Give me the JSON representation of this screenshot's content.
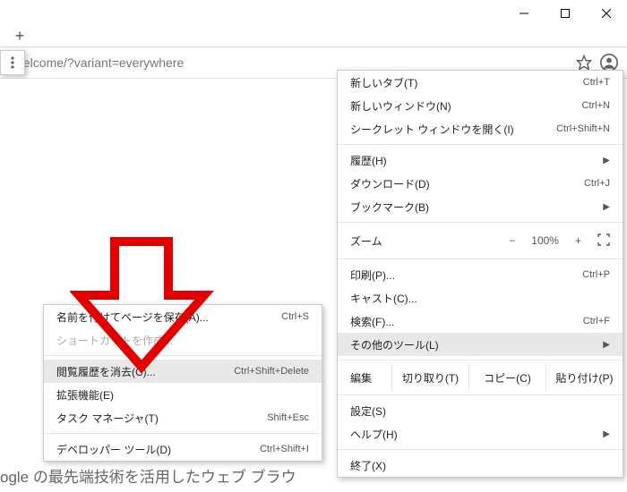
{
  "titlebar": {
    "minimize": "—",
    "maximize": "□",
    "close": "×"
  },
  "tabs": {
    "newtab": "+"
  },
  "address": {
    "url": "//welcome/?variant=everywhere"
  },
  "main_menu": {
    "new_tab": {
      "label": "新しいタブ(T)",
      "shortcut": "Ctrl+T"
    },
    "new_window": {
      "label": "新しいウィンドウ(N)",
      "shortcut": "Ctrl+N"
    },
    "incognito": {
      "label": "シークレット ウィンドウを開く(I)",
      "shortcut": "Ctrl+Shift+N"
    },
    "history": {
      "label": "履歴(H)"
    },
    "downloads": {
      "label": "ダウンロード(D)",
      "shortcut": "Ctrl+J"
    },
    "bookmarks": {
      "label": "ブックマーク(B)"
    },
    "zoom": {
      "label": "ズーム",
      "minus": "−",
      "value": "100%",
      "plus": "+",
      "fullscreen": "⛶"
    },
    "print": {
      "label": "印刷(P)...",
      "shortcut": "Ctrl+P"
    },
    "cast": {
      "label": "キャスト(C)..."
    },
    "find": {
      "label": "検索(F)...",
      "shortcut": "Ctrl+F"
    },
    "more_tools": {
      "label": "その他のツール(L)"
    },
    "edit": {
      "label": "編集",
      "cut": "切り取り(T)",
      "copy": "コピー(C)",
      "paste": "貼り付け(P)"
    },
    "settings": {
      "label": "設定(S)"
    },
    "help": {
      "label": "ヘルプ(H)"
    },
    "exit": {
      "label": "終了(X)"
    }
  },
  "sub_menu": {
    "save_as": {
      "label": "名前を付けてページを保存(A)...",
      "shortcut": "Ctrl+S"
    },
    "create_shortcut": {
      "label": "ショートカットを作成..."
    },
    "clear_browsing": {
      "label": "閲覧履歴を消去(C)...",
      "shortcut": "Ctrl+Shift+Delete"
    },
    "extensions": {
      "label": "拡張機能(E)"
    },
    "task_manager": {
      "label": "タスク マネージャ(T)",
      "shortcut": "Shift+Esc"
    },
    "dev_tools": {
      "label": "デベロッパー ツール(D)",
      "shortcut": "Ctrl+Shift+I"
    }
  },
  "page": {
    "partial_text": "ogle の最先端技術を活用したウェブ ブラウ"
  }
}
